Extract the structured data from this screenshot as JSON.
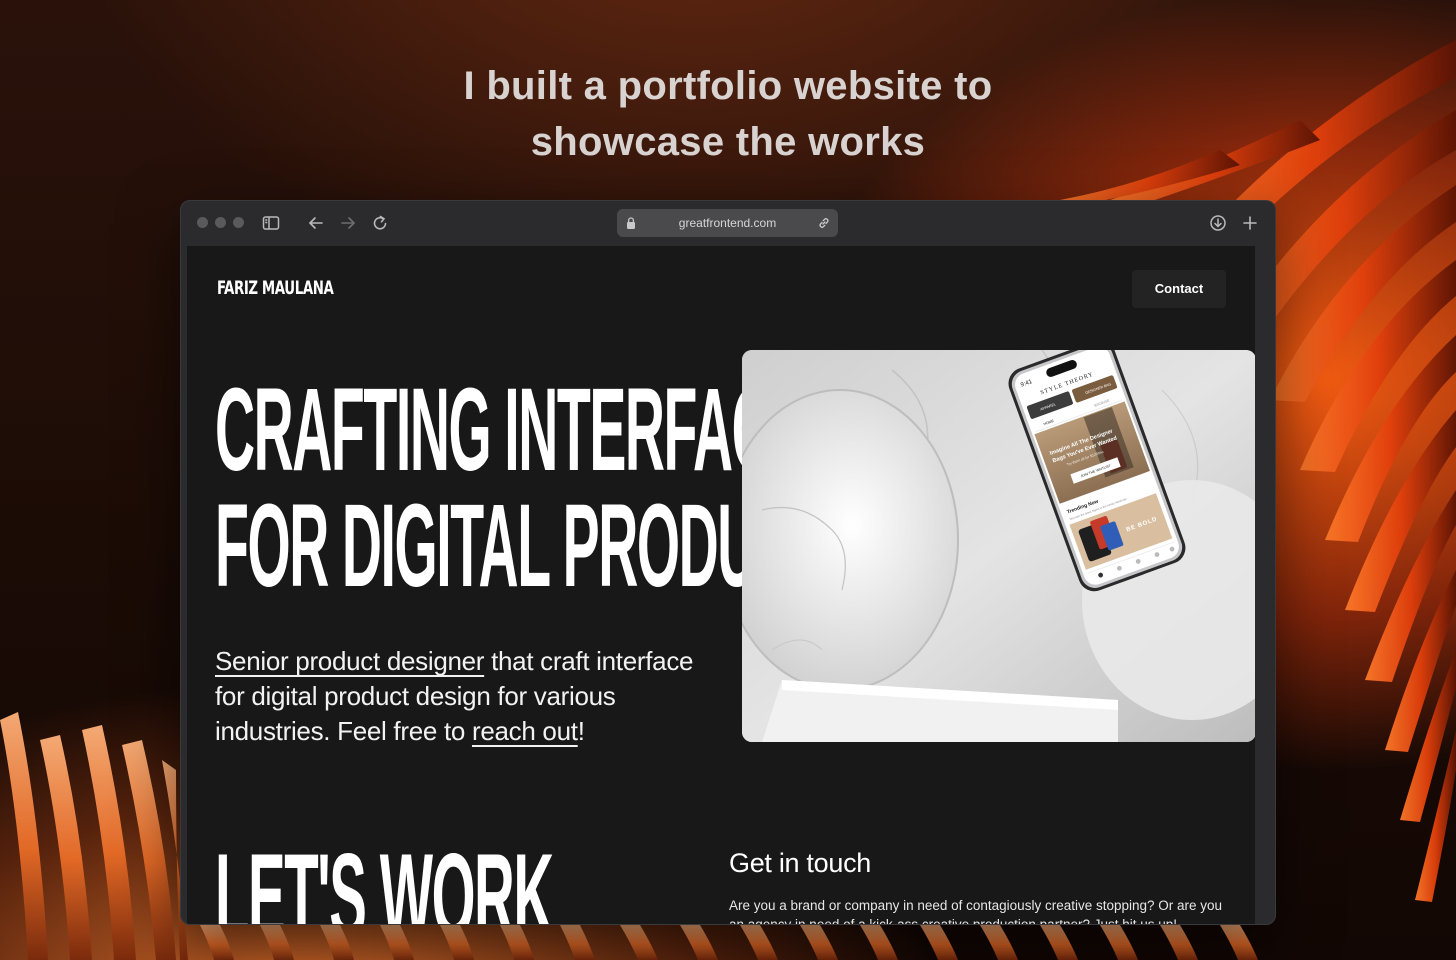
{
  "headline": {
    "line1": "I built a portfolio website to",
    "line2": "showcase the works"
  },
  "browser": {
    "url": "greatfrontend.com",
    "icons": {
      "sidebar": "sidebar-toggle-icon",
      "back": "arrow-left-icon",
      "forward": "arrow-right-icon",
      "reload": "reload-icon",
      "lock": "lock-icon",
      "share_link": "link-icon",
      "download": "download-icon",
      "new_tab": "plus-icon"
    }
  },
  "site": {
    "logo": "FARIZ MAULANA",
    "contact_label": "Contact",
    "hero": {
      "title_line1": "CRAFTING INTERFACE",
      "title_line2": "FOR DIGITAL PRODUCT",
      "subtitle_link1": "Senior product designer",
      "subtitle_text1": " that craft interface for digital product design for various industries. Feel free to ",
      "subtitle_link2": "reach out",
      "subtitle_text2": "!"
    },
    "phone_mockup": {
      "status_time": "9:41",
      "brand": "STYLE THEORY",
      "category_1": "APPAREL",
      "category_2": "DESIGNER BAG",
      "tab_home": "HOME",
      "tab_2": "BROWSE",
      "banner_line1": "Imagine All The Designer",
      "banner_line2": "Bags You've Ever Wanted",
      "banner_sub": "Try them all for $129/mo",
      "banner_cta": "JOIN THE WAITLIST",
      "trending_title": "Trending Now",
      "trending_sub": "Discover the latest Styles in the trendy Wardrobe",
      "promo_text": "BE BOLD"
    },
    "lets_work": "LET'S WORK",
    "contact_section": {
      "title": "Get in touch",
      "body": "Are you a brand or company in need of contagiously creative stopping? Or are you an agency in need of a kick-ass creative production partner? Just hit us up!"
    },
    "colors": {
      "page_bg": "#181818",
      "button_bg": "#232323",
      "text": "#ffffff",
      "accent_orange": "#ff5a14"
    }
  }
}
